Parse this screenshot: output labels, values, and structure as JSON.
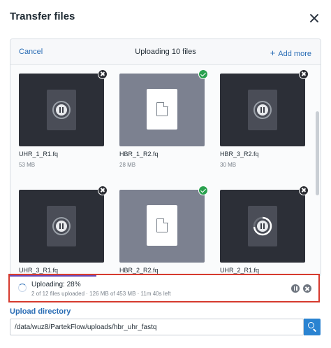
{
  "dialog": {
    "title": "Transfer files"
  },
  "panel": {
    "cancel_label": "Cancel",
    "status_title": "Uploading 10 files",
    "add_more_label": "Add more"
  },
  "files": [
    {
      "name": "UHR_1_R1.fq",
      "size": "53 MB",
      "state": "paused"
    },
    {
      "name": "HBR_1_R2.fq",
      "size": "28 MB",
      "state": "complete"
    },
    {
      "name": "HBR_3_R2.fq",
      "size": "30 MB",
      "state": "paused"
    },
    {
      "name": "UHR_3_R1.fq",
      "size": "",
      "state": "paused"
    },
    {
      "name": "HBR_2_R2.fq",
      "size": "",
      "state": "complete"
    },
    {
      "name": "UHR_2_R1.fq",
      "size": "",
      "state": "uploading"
    }
  ],
  "status_bar": {
    "title": "Uploading: 28%",
    "detail": "2 of 12 files uploaded · 126 MB of 453 MB · 11m 40s left",
    "progress": 0.28,
    "progress_color": "#6b4bb8"
  },
  "upload_directory": {
    "label": "Upload directory",
    "value": "/data/wuz8/PartekFlow/uploads/hbr_uhr_fastq"
  },
  "colors": {
    "accent": "#2a6db5",
    "highlight_border": "#d63a2e",
    "complete": "#2aa14f"
  }
}
